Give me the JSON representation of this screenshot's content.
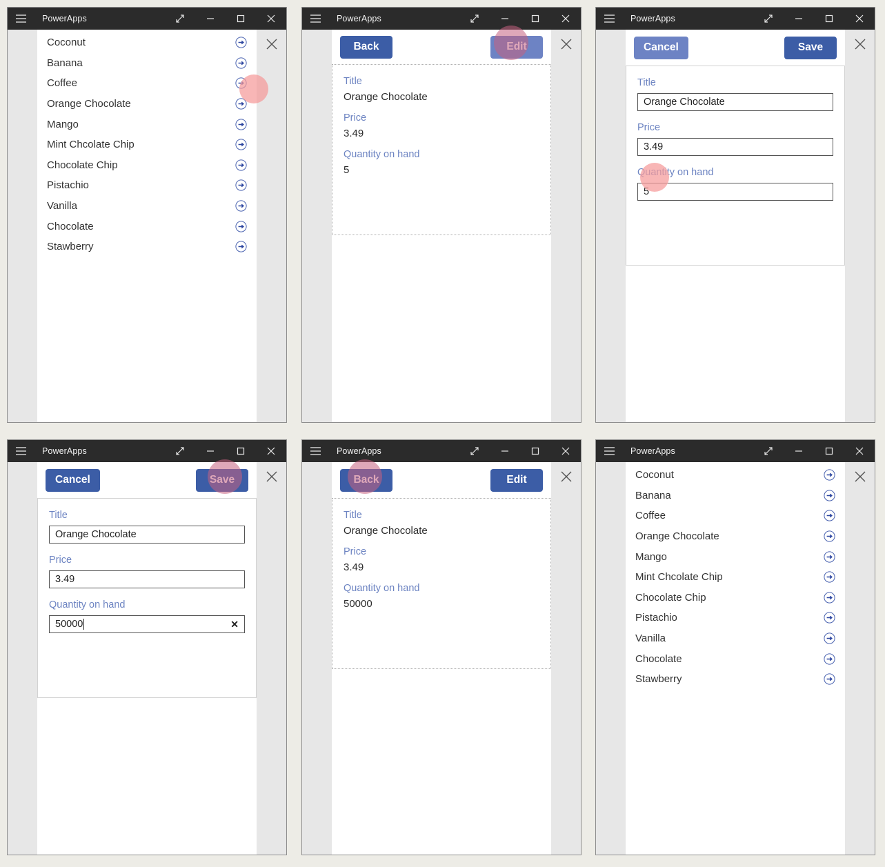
{
  "window": {
    "title": "PowerApps",
    "controls": {
      "menu": "hamburger-menu",
      "restore": "expand-arrows",
      "minimize": "minimize",
      "maximize": "maximize",
      "close": "close"
    },
    "app_close": "close"
  },
  "colors": {
    "titlebar": "#2b2b2b",
    "page_background": "#edece6",
    "rail": "#e7e7e7",
    "button_primary": "#3c5da6",
    "button_hover": "#6d83c4",
    "label_blue": "#6d84c2",
    "click_highlight": "#f59a9a",
    "arrow_blue": "#3c5da6"
  },
  "list": {
    "items": [
      {
        "label": "Coconut",
        "icon": "arrow-right-circle-icon"
      },
      {
        "label": "Banana",
        "icon": "arrow-right-circle-icon"
      },
      {
        "label": "Coffee",
        "icon": "arrow-right-circle-icon"
      },
      {
        "label": "Orange Chocolate",
        "icon": "arrow-right-circle-icon"
      },
      {
        "label": "Mango",
        "icon": "arrow-right-circle-icon"
      },
      {
        "label": "Mint Chcolate Chip",
        "icon": "arrow-right-circle-icon"
      },
      {
        "label": "Chocolate Chip",
        "icon": "arrow-right-circle-icon"
      },
      {
        "label": "Pistachio",
        "icon": "arrow-right-circle-icon"
      },
      {
        "label": "Vanilla",
        "icon": "arrow-right-circle-icon"
      },
      {
        "label": "Chocolate",
        "icon": "arrow-right-circle-icon"
      },
      {
        "label": "Stawberry",
        "icon": "arrow-right-circle-icon"
      }
    ]
  },
  "labels": {
    "title": "Title",
    "price": "Price",
    "quantity": "Quantity on hand"
  },
  "buttons": {
    "back": "Back",
    "edit": "Edit",
    "cancel": "Cancel",
    "save": "Save",
    "clear": "✕"
  },
  "record_before": {
    "title": "Orange Chocolate",
    "price": "3.49",
    "quantity": "5"
  },
  "record_after": {
    "title": "Orange Chocolate",
    "price": "3.49",
    "quantity": "50000"
  },
  "panels": [
    {
      "id": "panel-1",
      "screen": "browse-list",
      "step": 1
    },
    {
      "id": "panel-2",
      "screen": "detail-view",
      "step": 2
    },
    {
      "id": "panel-3",
      "screen": "edit-form",
      "step": 3
    },
    {
      "id": "panel-4",
      "screen": "edit-form-filled",
      "step": 4
    },
    {
      "id": "panel-5",
      "screen": "detail-view-updated",
      "step": 5
    },
    {
      "id": "panel-6",
      "screen": "browse-list-final",
      "step": 6
    }
  ]
}
